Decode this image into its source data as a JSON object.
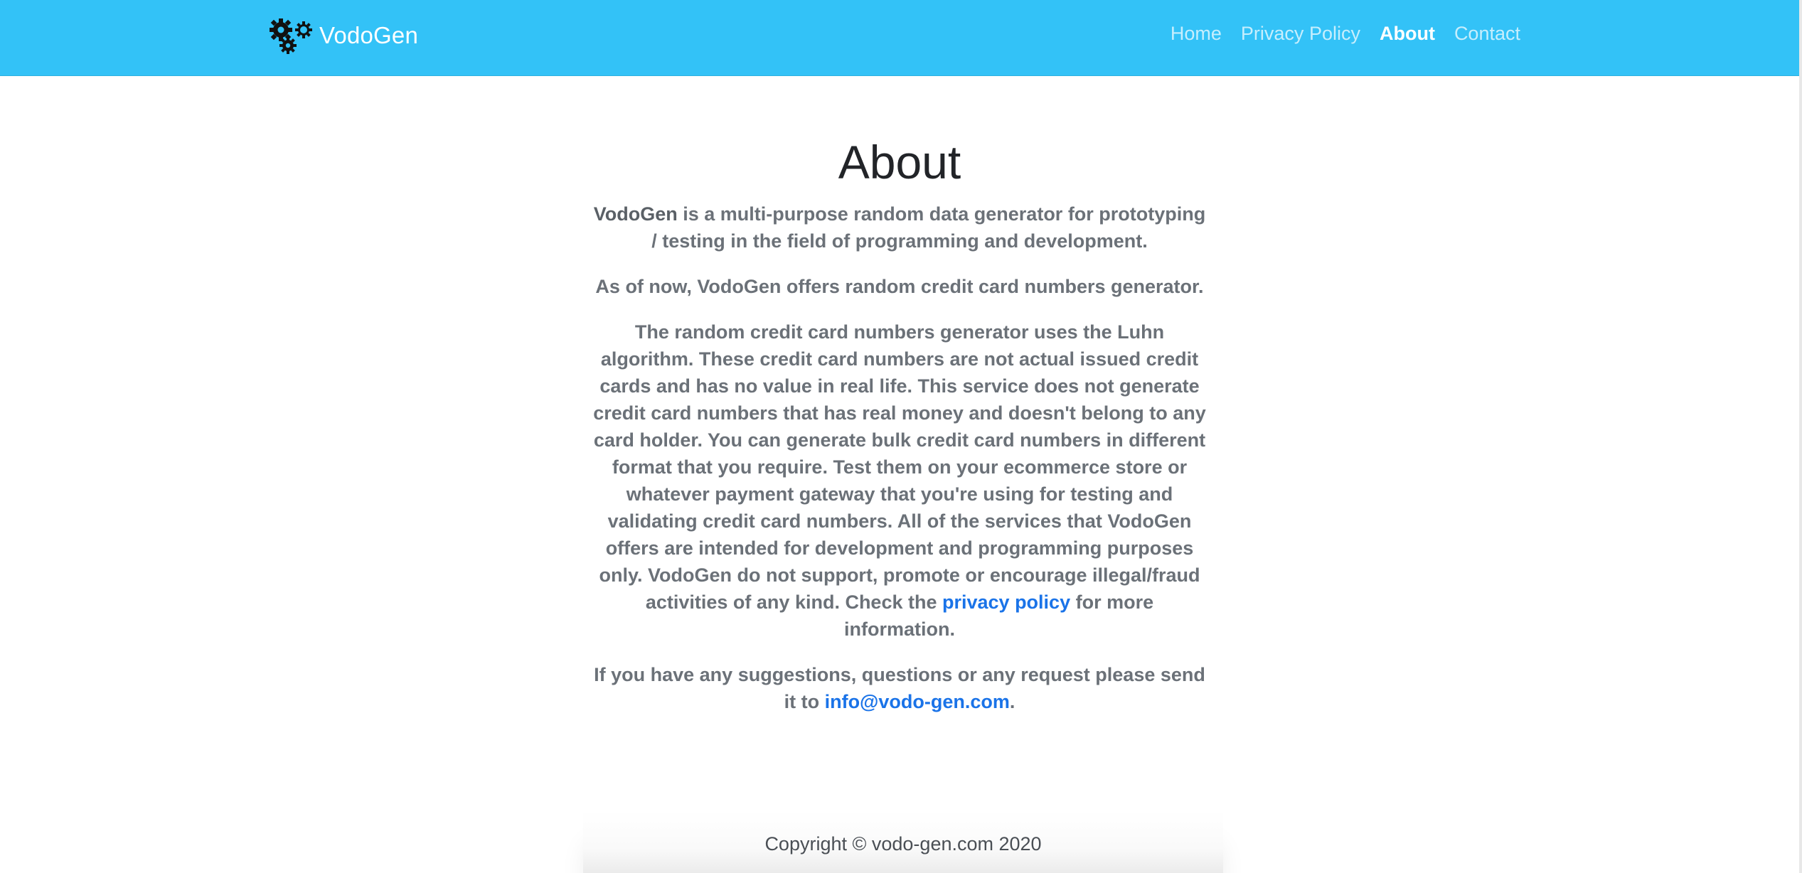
{
  "navbar": {
    "brand_name": "VodoGen",
    "brand_icon": "gears-icon",
    "links": [
      {
        "label": "Home"
      },
      {
        "label": "Privacy Policy"
      },
      {
        "label": "About"
      },
      {
        "label": "Contact"
      }
    ],
    "active_link": "About",
    "background_color": "#33c2f7"
  },
  "main": {
    "title": "About",
    "intro_brand": "VodoGen",
    "intro_rest": " is a multi-purpose random data generator for prototyping / testing in the field of programming and development.",
    "offer_text": "As of now, VodoGen offers random credit card numbers generator.",
    "details_before_link": "The random credit card numbers generator uses the Luhn algorithm. These credit card numbers are not actual issued credit cards and has no value in real life. This service does not generate credit card numbers that has real money and doesn't belong to any card holder. You can generate bulk credit card numbers in different format that you require. Test them on your ecommerce store or whatever payment gateway that you're using for testing and validating credit card numbers. All of the services that VodoGen offers are intended for development and programming purposes only. VodoGen do not support, promote or encourage illegal/fraud activities of any kind. Check the ",
    "privacy_link_label": "privacy policy",
    "details_after_link": " for more information.",
    "contact_before": "If you have any suggestions, questions or any request please send it to ",
    "contact_email": "info@vodo-gen.com",
    "contact_after": ".",
    "link_color": "#1a73e8"
  },
  "footer": {
    "copyright": "Copyright © vodo-gen.com 2020"
  }
}
